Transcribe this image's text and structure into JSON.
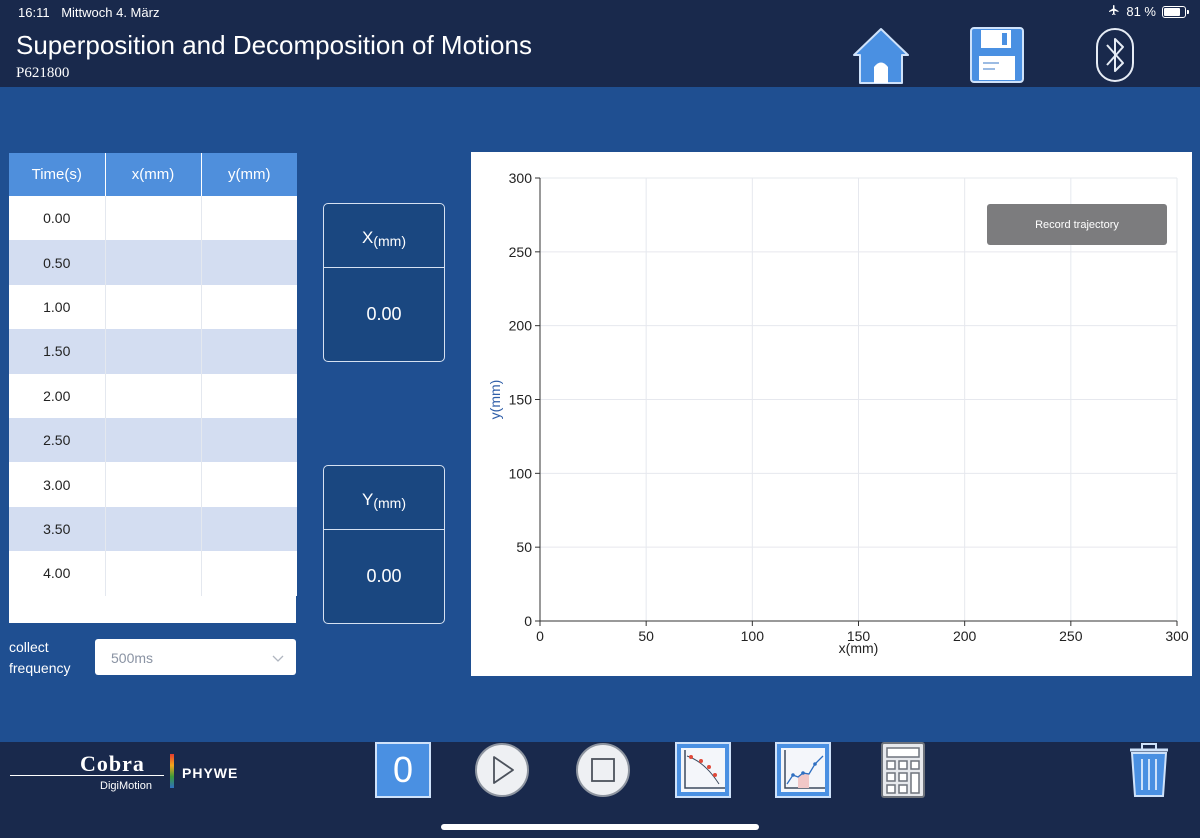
{
  "status_bar": {
    "time": "16:11",
    "date": "Mittwoch 4. März",
    "battery": "81 %",
    "battery_level": 0.81
  },
  "header": {
    "title": "Superposition and Decomposition of Motions",
    "subtitle": "P621800",
    "icons": [
      "home-icon",
      "save-disk-icon",
      "bluetooth-icon"
    ]
  },
  "table": {
    "headers": [
      "Time(s)",
      "x(mm)",
      "y(mm)"
    ],
    "rows": [
      [
        "0.00",
        "",
        ""
      ],
      [
        "0.50",
        "",
        ""
      ],
      [
        "1.00",
        "",
        ""
      ],
      [
        "1.50",
        "",
        ""
      ],
      [
        "2.00",
        "",
        ""
      ],
      [
        "2.50",
        "",
        ""
      ],
      [
        "3.00",
        "",
        ""
      ],
      [
        "3.50",
        "",
        ""
      ],
      [
        "4.00",
        "",
        ""
      ]
    ]
  },
  "frequency": {
    "label_line1": "collect",
    "label_line2": "frequency",
    "value": "500ms"
  },
  "x_box": {
    "label": "X",
    "unit": "(mm)",
    "value": "0.00"
  },
  "y_box": {
    "label": "Y",
    "unit": "(mm)",
    "value": "0.00"
  },
  "chart_data": {
    "type": "scatter",
    "xlabel": "x(mm)",
    "ylabel": "y(mm)",
    "xlim": [
      0,
      300
    ],
    "ylim": [
      0,
      300
    ],
    "xticks": [
      "0",
      "50",
      "100",
      "150",
      "200",
      "250",
      "300"
    ],
    "yticks": [
      "0",
      "50",
      "100",
      "150",
      "200",
      "250",
      "300"
    ],
    "grid": true,
    "series": [],
    "record_button": "Record trajectory"
  },
  "footer": {
    "brand_name": "Cobra",
    "brand_sub": "DigiMotion",
    "brand_partner": "PHYWE",
    "zero_button": "0",
    "buttons": [
      "zero-button",
      "play-button",
      "stop-button",
      "curve-graph-button",
      "area-graph-button",
      "calculator-button",
      "trash-button"
    ]
  },
  "colors": {
    "background": "#1f4f91",
    "bar": "#19294c",
    "table_header": "#4f8fdc",
    "row_stripe": "#d3ddf1",
    "icon_blue": "#4a90e2"
  }
}
